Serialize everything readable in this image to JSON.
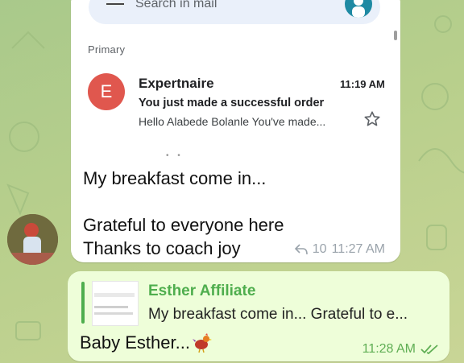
{
  "gmail": {
    "search_placeholder": "Search in mail",
    "section": "Primary",
    "email": {
      "avatar_letter": "E",
      "sender": "Expertnaire",
      "time": "11:19 AM",
      "subject": "You just made a successful order",
      "preview": "Hello Alabede Bolanle You've made..."
    }
  },
  "incoming": {
    "lines": [
      "My breakfast come in...",
      "",
      "Grateful to everyone here",
      "Thanks to coach joy"
    ],
    "replies": "10",
    "time": "11:27 AM"
  },
  "outgoing": {
    "quote_name": "Esther Affiliate",
    "quote_text": "My breakfast come in...  Grateful to e...",
    "text": "Baby Esther...",
    "time": "11:28 AM"
  },
  "colors": {
    "accent_green": "#4fae4e",
    "avatar_red": "#e0574e",
    "outgoing_bg": "#eefed9"
  }
}
